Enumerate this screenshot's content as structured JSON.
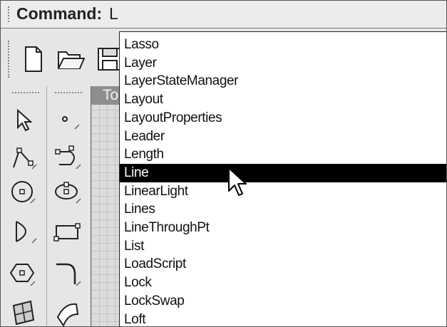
{
  "command_bar": {
    "label": "Command:",
    "value": "L"
  },
  "toolbar": {
    "buttons": [
      {
        "name": "new-file-icon"
      },
      {
        "name": "open-folder-icon"
      },
      {
        "name": "save-icon"
      }
    ]
  },
  "viewport": {
    "title": "To"
  },
  "palette_tools": [
    "select-arrow-icon",
    "point-icon",
    "polyline-icon",
    "curve-icon",
    "circle-icon",
    "ellipse-icon",
    "arc-icon",
    "rectangle-icon",
    "polygon-icon",
    "fillet-icon",
    "surface-icon",
    "solid-icon"
  ],
  "autocomplete": {
    "items": [
      "Lasso",
      "Layer",
      "LayerStateManager",
      "Layout",
      "LayoutProperties",
      "Leader",
      "Length",
      "Line",
      "LinearLight",
      "Lines",
      "LineThroughPt",
      "List",
      "LoadScript",
      "Lock",
      "LockSwap",
      "Loft"
    ],
    "selected": "Line"
  },
  "colors": {
    "selection": "#000000",
    "viewport_title": "#8e8e8e",
    "background": "#e6e6e6"
  }
}
